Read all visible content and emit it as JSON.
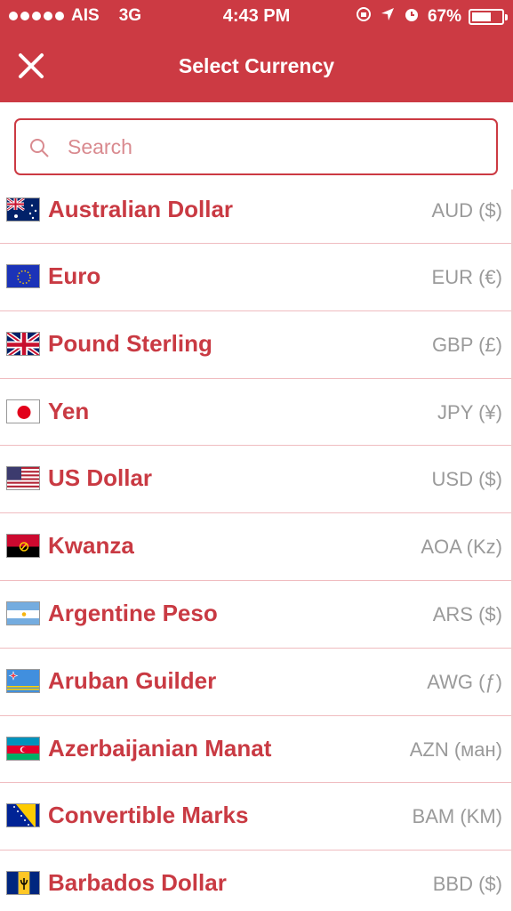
{
  "status_bar": {
    "carrier": "AIS",
    "network": "3G",
    "time": "4:43 PM",
    "battery": "67%",
    "battery_level": 0.67
  },
  "nav": {
    "title": "Select Currency",
    "close_icon": "close-icon"
  },
  "search": {
    "placeholder": "Search",
    "value": ""
  },
  "colors": {
    "accent": "#cc3a43",
    "code_text": "#9a9a9a",
    "divider": "#f0bcc0"
  },
  "currencies": [
    {
      "name": "Australian Dollar",
      "code": "AUD ($)",
      "flag": "australia-flag-icon"
    },
    {
      "name": "Euro",
      "code": "EUR (€)",
      "flag": "eu-flag-icon"
    },
    {
      "name": "Pound Sterling",
      "code": "GBP (£)",
      "flag": "uk-flag-icon"
    },
    {
      "name": "Yen",
      "code": "JPY (¥)",
      "flag": "japan-flag-icon"
    },
    {
      "name": "US Dollar",
      "code": "USD ($)",
      "flag": "usa-flag-icon"
    },
    {
      "name": "Kwanza",
      "code": "AOA (Kz)",
      "flag": "angola-flag-icon"
    },
    {
      "name": "Argentine Peso",
      "code": "ARS ($)",
      "flag": "argentina-flag-icon"
    },
    {
      "name": "Aruban Guilder",
      "code": "AWG (ƒ)",
      "flag": "aruba-flag-icon"
    },
    {
      "name": "Azerbaijanian Manat",
      "code": "AZN (ман)",
      "flag": "azerbaijan-flag-icon"
    },
    {
      "name": "Convertible Marks",
      "code": "BAM (KM)",
      "flag": "bosnia-flag-icon"
    },
    {
      "name": "Barbados Dollar",
      "code": "BBD ($)",
      "flag": "barbados-flag-icon"
    }
  ]
}
